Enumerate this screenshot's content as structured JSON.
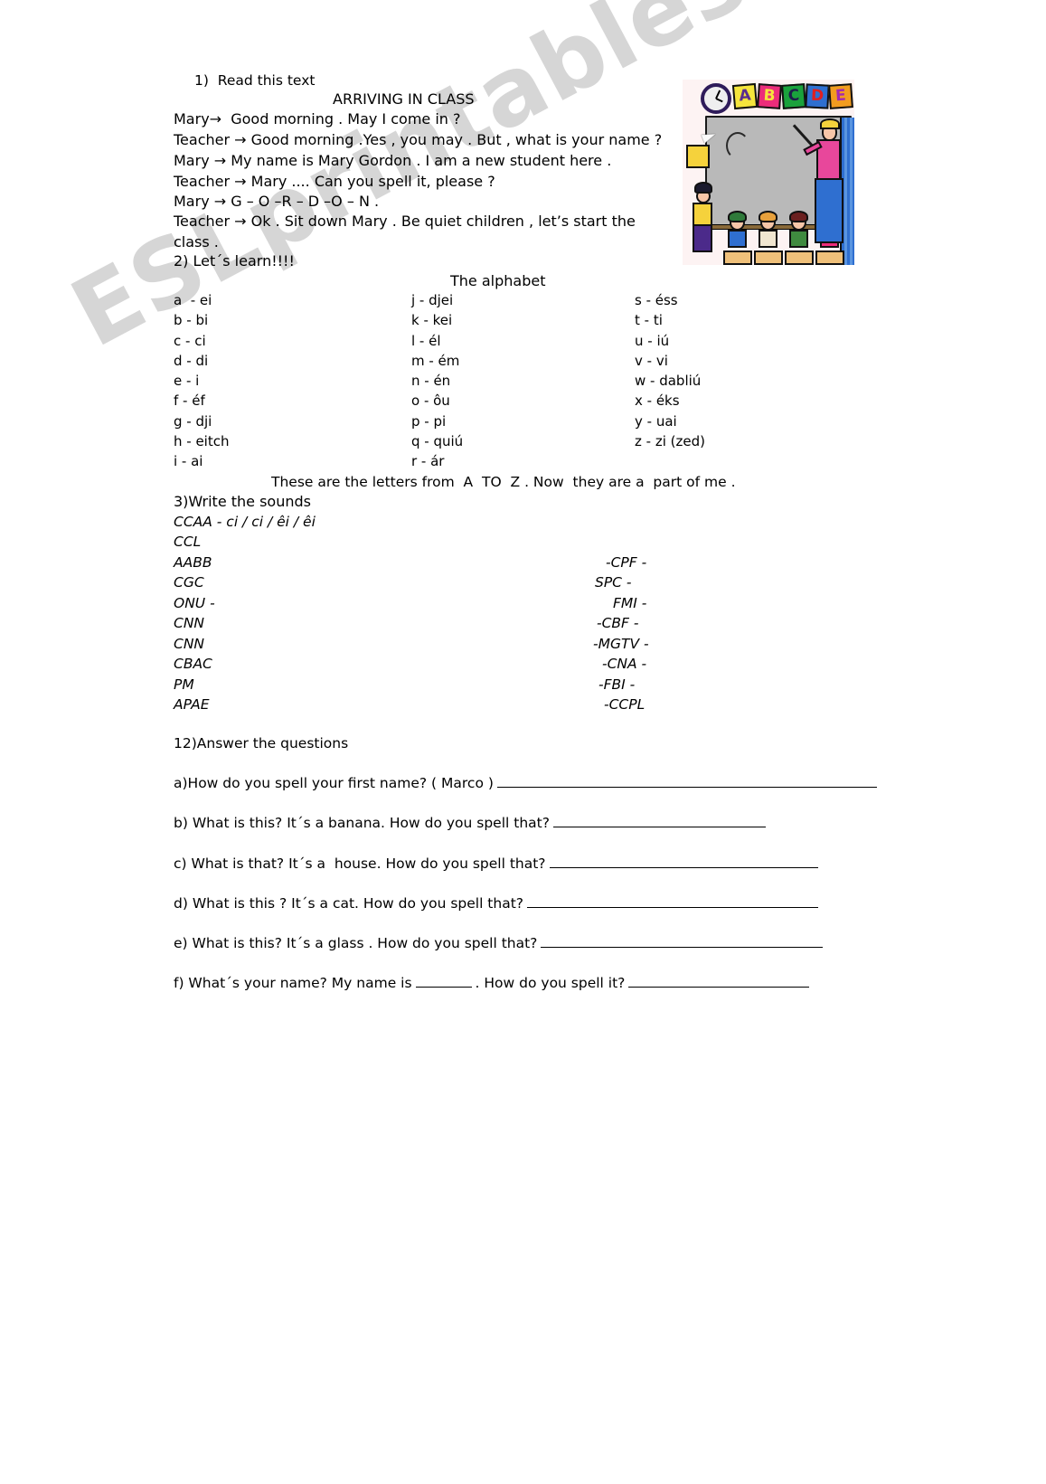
{
  "watermark": {
    "text": "ESLprintables.com"
  },
  "exercise1": {
    "instruction": "1)  Read this text",
    "title": "ARRIVING IN CLASS",
    "dialogue": [
      "Mary→  Good morning . May I come in ?",
      "Teacher → Good morning .Yes , you may . But , what is your name ?",
      "Mary → My name is Mary Gordon . I am a new student here .",
      "Teacher → Mary .... Can you spell it, please ?",
      "Mary → G – O –R – D –O – N .",
      "Teacher → Ok . Sit down Mary . Be quiet children , let’s start the",
      "class ."
    ]
  },
  "exercise2": {
    "instruction": "2) Let´s learn!!!!",
    "title": "The alphabet",
    "column1": [
      "a  - ei",
      "b - bi",
      "c - ci",
      "d - di",
      "e - i",
      "f - éf",
      "g - dji",
      "h - eitch",
      "i - ai"
    ],
    "column2": [
      "j - djei",
      "k - kei",
      "l - él",
      "m - ém",
      "n - én",
      "o - ôu",
      "p - pi",
      "q - quiú",
      "r - ár"
    ],
    "column3": [
      "s - éss",
      "t - ti",
      "u - iú",
      "v - vi",
      "w - dabliú",
      "x - éks",
      "y - uai",
      "z - zi (zed)"
    ],
    "footer": "These are the letters from  A  TO  Z . Now  they are a  part of me ."
  },
  "exercise3": {
    "instruction": "3)Write the sounds",
    "example": "CCAA - ci / ci / êi / êi",
    "left_column": [
      "CCL",
      "AABB",
      "CGC",
      "ONU -",
      "CNN",
      "CNN",
      "CBAC",
      "PM",
      "APAE"
    ],
    "right_column": [
      "",
      "-CPF -",
      "SPC -",
      "FMI -",
      "-CBF -",
      "-MGTV -",
      "-CNA -",
      "-FBI -",
      "-CCPL"
    ]
  },
  "exercise12": {
    "instruction": "12)Answer the questions",
    "questions": [
      {
        "text": "a)How do you spell your first name? ( Marco )",
        "line_width": 420
      },
      {
        "text": "b) What is this? It´s a banana. How do you spell that?",
        "line_width": 235
      },
      {
        "text": "c) What is that? It´s a  house. How do you spell that?",
        "line_width": 297
      },
      {
        "text": "d) What is this ? It´s a cat. How do you spell that?",
        "line_width": 322
      },
      {
        "text": "e) What is this? It´s a glass . How do you spell that?",
        "line_width": 312
      }
    ],
    "last_question": {
      "prefix": "f) What´s your name? My name is",
      "middle": ". How do you spell it?",
      "line_width": 200
    }
  },
  "illustration": {
    "name": "classroom-scene",
    "letter_cards": [
      {
        "letter": "A",
        "card_color": "#f5e53c",
        "text_color": "#5b2d8e"
      },
      {
        "letter": "B",
        "card_color": "#ec2c7a",
        "text_color": "#f5e53c"
      },
      {
        "letter": "C",
        "card_color": "#1aa23c",
        "text_color": "#1d1d4a"
      },
      {
        "letter": "D",
        "card_color": "#2f6fd0",
        "text_color": "#e02020"
      },
      {
        "letter": "E",
        "card_color": "#f29c1f",
        "text_color": "#a32ab0"
      }
    ],
    "board_color": "#b9b9b9",
    "background_color": "#fdf3f3",
    "students": [
      {
        "hair_color": "#2f7a3a",
        "shirt_color": "#2f6fd0"
      },
      {
        "hair_color": "#e8a13c",
        "shirt_color": "#f0e6d0"
      },
      {
        "hair_color": "#6b2020",
        "shirt_color": "#3f8a3f"
      },
      {
        "hair_color": "#e8793c",
        "shirt_color": "#ec2c7a"
      }
    ]
  }
}
